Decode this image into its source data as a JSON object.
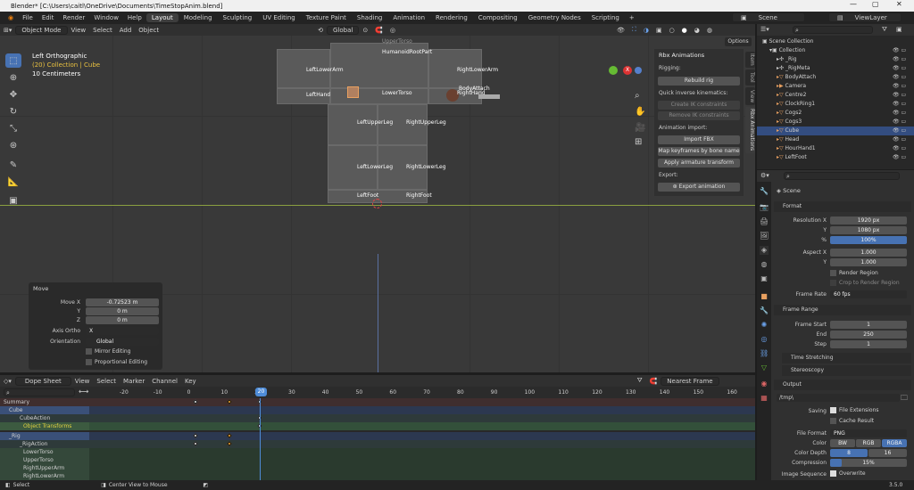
{
  "title_bar": {
    "title": "Blender* [C:\\Users\\caitl\\OneDrive\\Documents\\TimeStopAnim.blend]",
    "minimize": "—",
    "maximize": "▢",
    "close": "✕"
  },
  "menu": {
    "items": [
      "File",
      "Edit",
      "Render",
      "Window",
      "Help"
    ],
    "workspaces": [
      "Layout",
      "Modeling",
      "Sculpting",
      "UV Editing",
      "Texture Paint",
      "Shading",
      "Animation",
      "Rendering",
      "Compositing",
      "Geometry Nodes",
      "Scripting"
    ],
    "active_workspace": "Layout",
    "scene": "Scene",
    "view_layer": "ViewLayer"
  },
  "viewport_header": {
    "mode": "Object Mode",
    "menus": [
      "View",
      "Select",
      "Add",
      "Object"
    ],
    "orientation": "Global",
    "options": "Options"
  },
  "viewport": {
    "view_name": "Left Orthographic",
    "collection_info": "(20) Collection | Cube",
    "scale": "10 Centimeters",
    "bone_labels": [
      "UpperTorso",
      "HumanoidRootPart",
      "LeftLowerArm",
      "RightLowerArm",
      "LeftHand",
      "LowerTorso",
      "RightHand",
      "BodyAttach",
      "LeftUpperLeg",
      "RightUpperLeg",
      "LeftLowerLeg",
      "RightLowerLeg",
      "LeftFoot",
      "RightFoot"
    ]
  },
  "rbx_panel": {
    "header": "Rbx Animations",
    "rigging_label": "Rigging:",
    "rebuild_rig": "Rebuild rig",
    "ik_label": "Quick inverse kinematics:",
    "create_ik": "Create IK constraints",
    "remove_ik": "Remove IK constraints",
    "anim_import_label": "Animation import:",
    "import_fbx": "Import FBX",
    "map_keyframes": "Map keyframes by bone name",
    "apply_armature": "Apply armature transform",
    "export_label": "Export:",
    "export_anim": "Export animation"
  },
  "side_tabs": [
    "Item",
    "Tool",
    "View",
    "Rbx Animations"
  ],
  "move_panel": {
    "title": "Move",
    "move_x_label": "Move X",
    "move_x": "-0.72523 m",
    "y_label": "Y",
    "y": "0 m",
    "z_label": "Z",
    "z": "0 m",
    "axis_ortho_label": "Axis Ortho",
    "axis_ortho": "X",
    "orientation_label": "Orientation",
    "orientation": "Global",
    "mirror_editing": "Mirror Editing",
    "proportional_editing": "Proportional Editing"
  },
  "dope_sheet": {
    "editor": "Dope Sheet",
    "menus": [
      "View",
      "Select",
      "Marker",
      "Channel",
      "Key"
    ],
    "snapping": "Nearest Frame",
    "current_frame": "20",
    "ruler": [
      "-20",
      "-10",
      "0",
      "10",
      "20",
      "30",
      "40",
      "50",
      "60",
      "70",
      "80",
      "90",
      "100",
      "110",
      "120",
      "130",
      "140",
      "150",
      "160"
    ],
    "channels": [
      "Summary",
      "Cube",
      "CubeAction",
      "Object Transforms",
      "_Rig",
      "_RigAction",
      "LowerTorso",
      "UpperTorso",
      "RightUpperArm",
      "RightLowerArm"
    ]
  },
  "status": {
    "select": "Select",
    "center": "Center View to Mouse",
    "version": "3.5.0"
  },
  "outliner": {
    "title": "Scene Collection",
    "items": [
      "Collection",
      "_Rig",
      "_RigMeta",
      "BodyAttach",
      "Camera",
      "Centre2",
      "ClockRing1",
      "Cogs2",
      "Cogs3",
      "Cube",
      "Head",
      "HourHand1",
      "LeftFoot"
    ],
    "selected": "Cube"
  },
  "properties": {
    "context": "Scene",
    "format_section": "Format",
    "res_x_label": "Resolution X",
    "res_x": "1920 px",
    "res_y_label": "Y",
    "res_y": "1080 px",
    "res_pct_label": "%",
    "res_pct": "100%",
    "aspect_x_label": "Aspect X",
    "aspect_x": "1.000",
    "aspect_y_label": "Y",
    "aspect_y": "1.000",
    "render_region": "Render Region",
    "crop_region": "Crop to Render Region",
    "frame_rate_label": "Frame Rate",
    "frame_rate": "60 fps",
    "frame_range_section": "Frame Range",
    "frame_start_label": "Frame Start",
    "frame_start": "1",
    "end_label": "End",
    "end": "250",
    "step_label": "Step",
    "step": "1",
    "time_stretching": "Time Stretching",
    "stereoscopy": "Stereoscopy",
    "output_section": "Output",
    "output_path": "/tmp\\",
    "saving_label": "Saving",
    "file_extensions": "File Extensions",
    "cache_result": "Cache Result",
    "file_format_label": "File Format",
    "file_format": "PNG",
    "color_label": "Color",
    "color_bw": "BW",
    "color_rgb": "RGB",
    "color_rgba": "RGBA",
    "color_depth_label": "Color Depth",
    "depth_8": "8",
    "depth_16": "16",
    "compression_label": "Compression",
    "compression": "15%",
    "image_sequence_label": "Image Sequence",
    "overwrite": "Overwrite"
  },
  "colors": {
    "accent": "#4772b3",
    "selected_bone": "#e8a060",
    "playhead": "#4e8cd8"
  }
}
